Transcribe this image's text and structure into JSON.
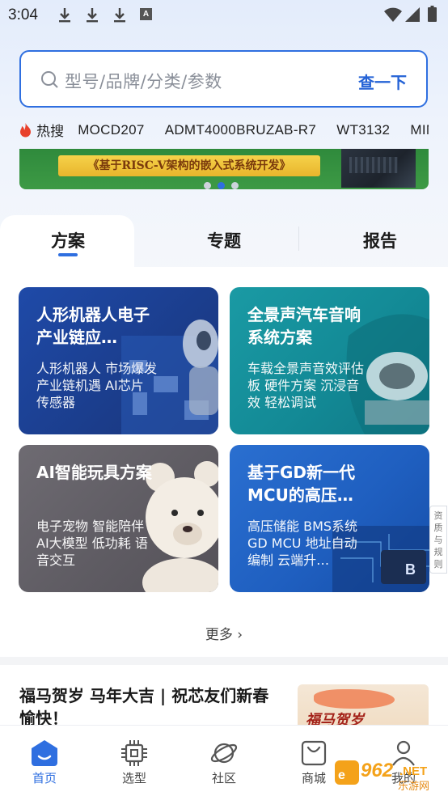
{
  "status_bar": {
    "time": "3:04",
    "notification_letter": "A"
  },
  "search": {
    "placeholder": "型号/品牌/分类/参数",
    "button": "查一下"
  },
  "hot_search": {
    "label": "热搜",
    "terms": [
      "MOCD207",
      "ADMT4000BRUZAB-R7",
      "WT3132",
      "MIMX"
    ]
  },
  "banner": {
    "text": "《基于RISC-V架构的嵌入式系统开发》",
    "page_count": 3,
    "active_page": 2
  },
  "tabs": [
    {
      "label": "方案",
      "active": true
    },
    {
      "label": "专题",
      "active": false
    },
    {
      "label": "报告",
      "active": false
    }
  ],
  "cards": [
    {
      "title": "人形机器人电子产业链应…",
      "desc": "人形机器人 市场爆发 产业链机遇 AI芯片 传感器"
    },
    {
      "title": "全景声汽车音响系统方案",
      "desc": "车载全景声音效评估板 硬件方案 沉浸音效 轻松调试"
    },
    {
      "title": "AI智能玩具方案",
      "desc": "电子宠物 智能陪伴 AI大模型 低功耗 语音交互"
    },
    {
      "title": "基于GD新一代MCU的高压…",
      "desc": "高压储能 BMS系统 GD MCU 地址自动编制 云端升…"
    }
  ],
  "side_tab": "资质与规则",
  "more": "更多",
  "article": {
    "title": "福马贺岁 马年大吉 | 祝芯友们新春愉快！",
    "thumb_text": "福马贺岁"
  },
  "nav": [
    {
      "label": "首页",
      "icon": "home-icon",
      "active": true
    },
    {
      "label": "选型",
      "icon": "chip-icon",
      "active": false
    },
    {
      "label": "社区",
      "icon": "planet-icon",
      "active": false
    },
    {
      "label": "商城",
      "icon": "shopping-bag-icon",
      "active": false
    },
    {
      "label": "我的",
      "icon": "user-icon",
      "active": false
    }
  ],
  "watermark": {
    "number": "962",
    "suffix": ".NET",
    "sub": "乐游网"
  },
  "colors": {
    "accent": "#2f6fe0",
    "card1": "#1f4aa8",
    "card2": "#1a9aa4",
    "card3": "#6e6b72",
    "card4": "#2a6fd0"
  }
}
